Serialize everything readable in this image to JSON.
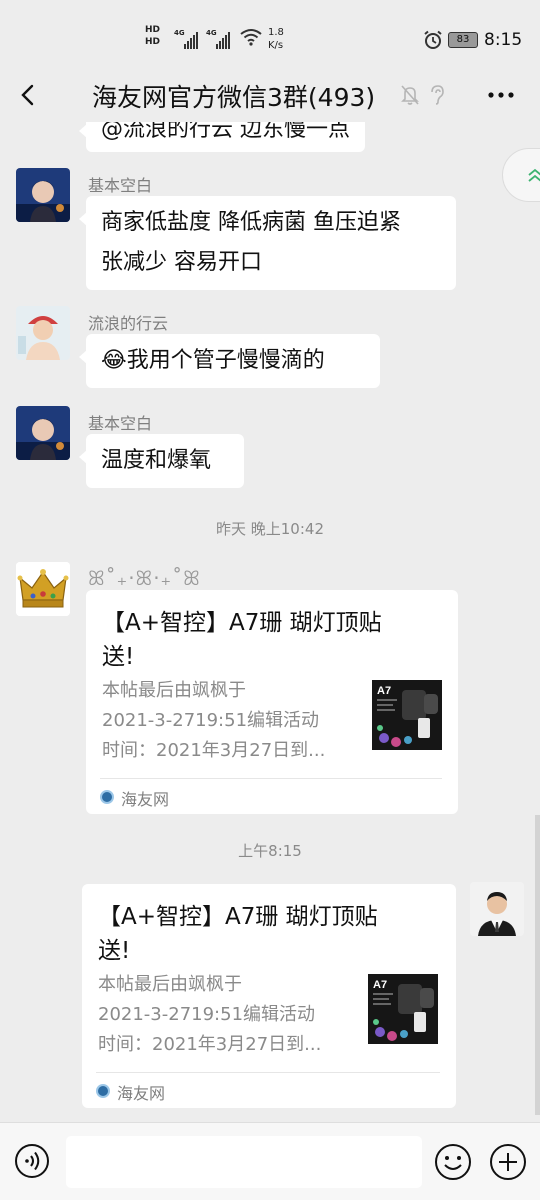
{
  "status_bar": {
    "hd1": "HD",
    "hd2": "HD",
    "net1": "4G",
    "net2": "4G",
    "speed_value": "1.8",
    "speed_unit": "K/s",
    "battery": "83",
    "time": "8:15"
  },
  "header": {
    "title": "海友网官方微信3群(493)"
  },
  "messages": {
    "partial_top": "@流浪的行云 边东慢一点",
    "m1": {
      "sender": "基本空白",
      "text_line1": "商家低盐度 降低病菌 鱼压迫紧",
      "text_line2": "张减少 容易开口"
    },
    "m2": {
      "sender": "流浪的行云",
      "emoji": "😂",
      "text": "我用个管子慢慢滴的"
    },
    "m3": {
      "sender": "基本空白",
      "text": "温度和爆氧"
    },
    "ts1": "昨天 晚上10:42",
    "card1": {
      "sender_decor": "ꕤ˚₊‧ꕤ‧₊˚ꕤ",
      "title_line1": "【A+智控】A7珊 瑚灯顶贴",
      "title_line2": "送!",
      "desc_line1": "本帖最后由飒枫于",
      "desc_line2": "2021-3-2719:51编辑活动",
      "desc_line3": "时间：2021年3月27日到...",
      "thumb_label": "A7",
      "source": "海友网"
    },
    "ts2": "上午8:15",
    "card2": {
      "title_line1": "【A+智控】A7珊 瑚灯顶贴",
      "title_line2": "送!",
      "desc_line1": "本帖最后由飒枫于",
      "desc_line2": "2021-3-2719:51编辑活动",
      "desc_line3": "时间：2021年3月27日到...",
      "thumb_label": "A7",
      "source": "海友网"
    }
  },
  "input": {
    "value": ""
  },
  "icons": {
    "back": "back-arrow-icon",
    "mute": "mute-bell-icon",
    "ear": "earpiece-icon",
    "more": "more-dots-icon",
    "voice": "voice-icon",
    "emoji": "emoji-icon",
    "plus": "plus-icon"
  },
  "colors": {
    "background": "#ededed",
    "bubble": "#ffffff",
    "secondary_text": "#8a8a8a",
    "source_icon": "#2e6da4"
  }
}
